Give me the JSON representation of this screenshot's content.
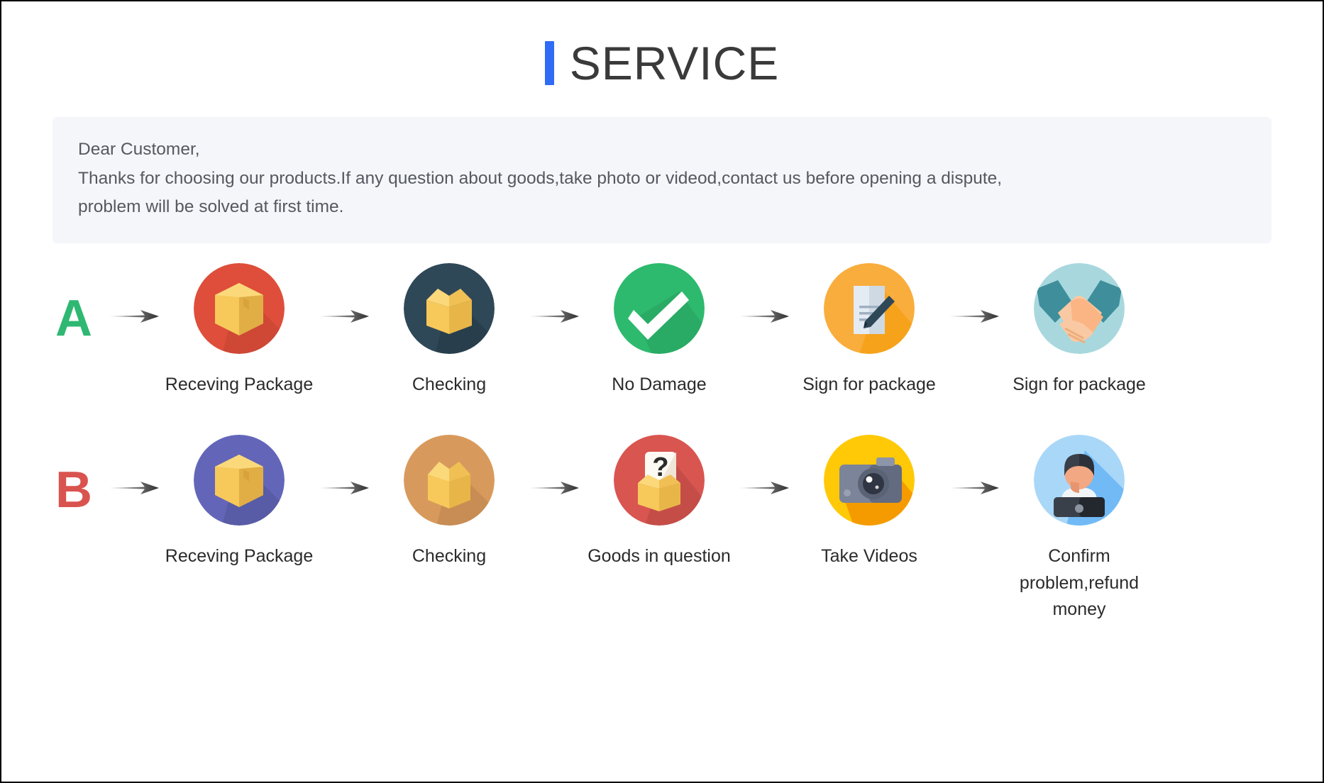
{
  "header": {
    "title": "SERVICE",
    "accent_color": "#2f6bf5"
  },
  "notice": {
    "line1": "Dear Customer,",
    "line2": "Thanks for choosing our products.If any question about goods,take photo or videod,contact us before opening a dispute,",
    "line3": "problem will be solved at first time.",
    "background_color": "#f4f6fa",
    "text_color": "#55585f"
  },
  "flows": [
    {
      "badge": "A",
      "badge_color": "#2eb872",
      "steps": [
        {
          "label": "Receving Package",
          "icon": "package-box-icon",
          "circle_color": "#de4e3a"
        },
        {
          "label": "Checking",
          "icon": "open-box-icon",
          "circle_color": "#2f4858"
        },
        {
          "label": "No Damage",
          "icon": "check-mark-icon",
          "circle_color": "#2dba6e"
        },
        {
          "label": "Sign for package",
          "icon": "document-sign-icon",
          "circle_color": "#f9ad3c"
        },
        {
          "label": "Sign for package",
          "icon": "handshake-icon",
          "circle_color": "#a8d8dd"
        }
      ]
    },
    {
      "badge": "B",
      "badge_color": "#d9534f",
      "steps": [
        {
          "label": "Receving Package",
          "icon": "package-box-icon",
          "circle_color": "#6366b8"
        },
        {
          "label": "Checking",
          "icon": "open-box-icon",
          "circle_color": "#d89a5c"
        },
        {
          "label": "Goods in question",
          "icon": "question-box-icon",
          "circle_color": "#d95550"
        },
        {
          "label": "Take Videos",
          "icon": "camera-icon",
          "circle_color": "#ffc907"
        },
        {
          "label": "Confirm problem,refund money",
          "icon": "support-agent-icon",
          "circle_color": "#a9d7f8"
        }
      ]
    }
  ],
  "arrow": {
    "name": "right-arrow-icon",
    "color": "#3c3c3c"
  }
}
